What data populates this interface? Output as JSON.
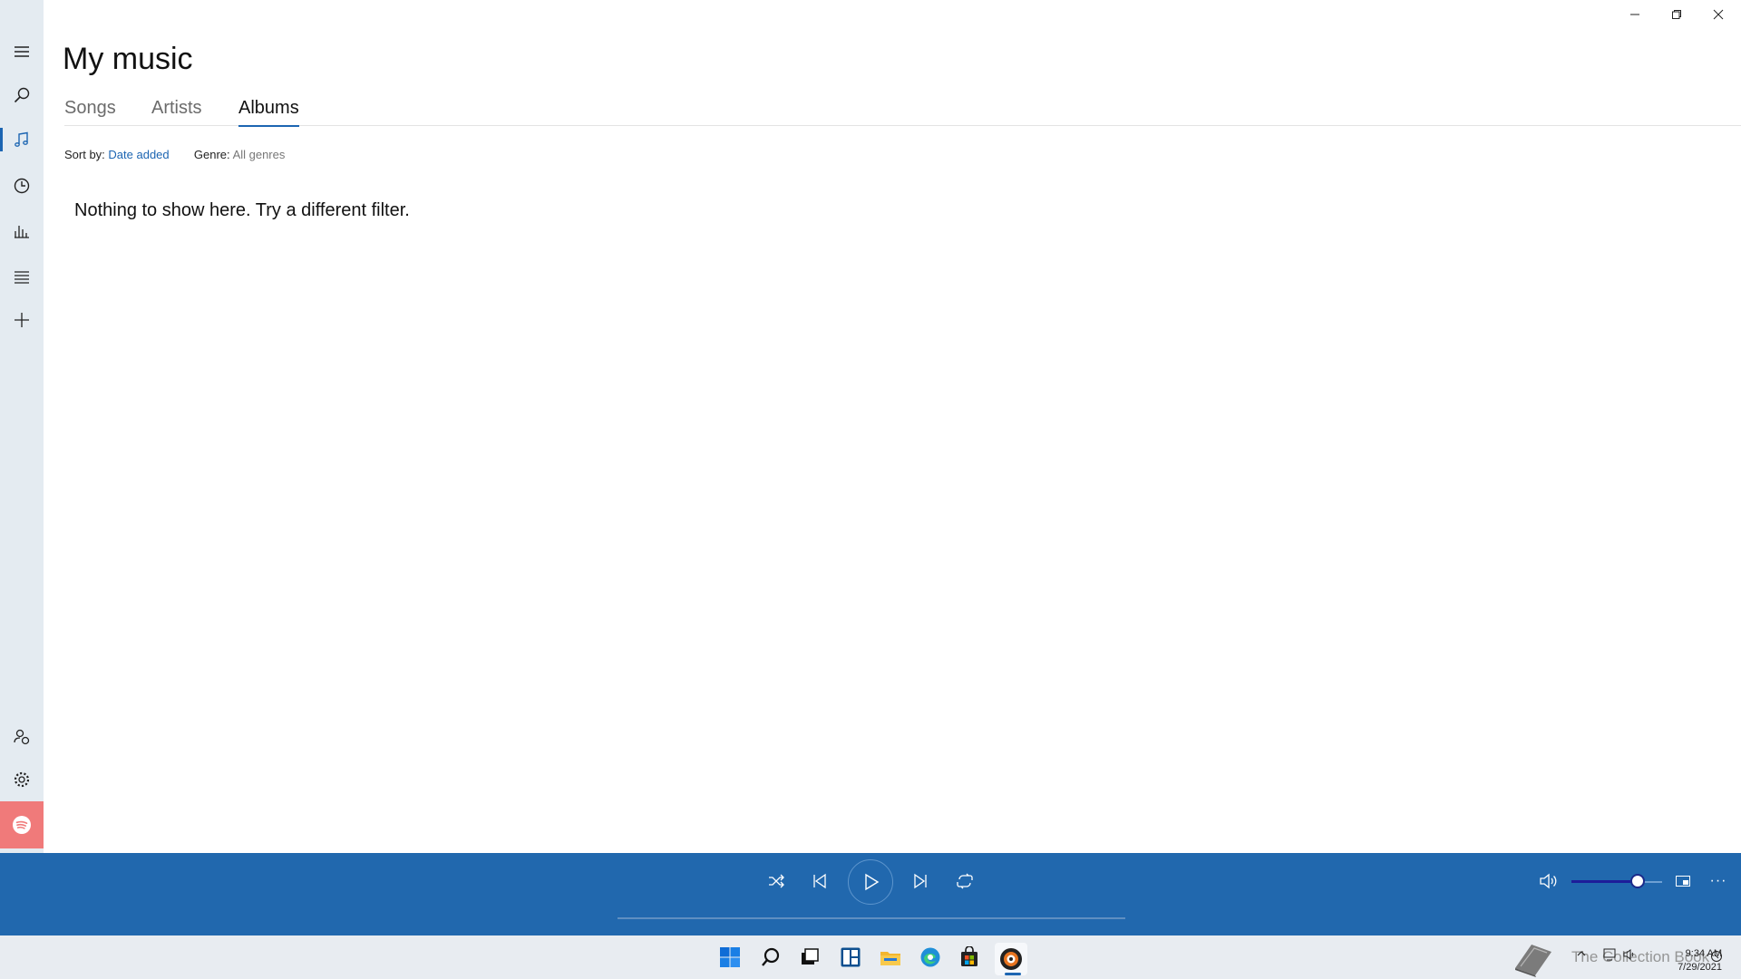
{
  "window": {
    "minimize": "–",
    "maximize": "❐",
    "close": "✕"
  },
  "sidebar": {
    "items": [
      {
        "name": "menu-icon"
      },
      {
        "name": "search-icon"
      },
      {
        "name": "my-music-icon",
        "active": true
      },
      {
        "name": "recent-icon"
      },
      {
        "name": "now-playing-icon"
      },
      {
        "name": "playlists-icon"
      },
      {
        "name": "add-icon"
      }
    ],
    "bottom": [
      {
        "name": "account-icon"
      },
      {
        "name": "settings-icon"
      },
      {
        "name": "spotify-icon"
      }
    ]
  },
  "page": {
    "title": "My music",
    "tabs": [
      {
        "label": "Songs",
        "active": false
      },
      {
        "label": "Artists",
        "active": false
      },
      {
        "label": "Albums",
        "active": true
      }
    ],
    "sort_label": "Sort by:",
    "sort_value": "Date added",
    "genre_label": "Genre:",
    "genre_value": "All genres",
    "empty_message": "Nothing to show here. Try a different filter."
  },
  "player": {
    "controls": [
      "shuffle-icon",
      "previous-icon",
      "play-icon",
      "next-icon",
      "repeat-icon"
    ],
    "right": [
      "volume-icon",
      "mini-view-icon",
      "more-icon"
    ],
    "volume_level": 0.72,
    "more_label": "···"
  },
  "taskbar": {
    "apps": [
      "start-icon",
      "search-icon",
      "task-view-icon",
      "widgets-icon",
      "file-explorer-icon",
      "edge-icon",
      "store-icon",
      "groove-music-icon"
    ],
    "watermark": "The Collection Book",
    "time": "9:34 AM",
    "date": "7/29/2021"
  },
  "colors": {
    "accent": "#1c65b2",
    "player_bg": "#2168ae",
    "sidebar_bg": "#e4ebf1",
    "taskbar_bg": "#e8ecf1"
  }
}
